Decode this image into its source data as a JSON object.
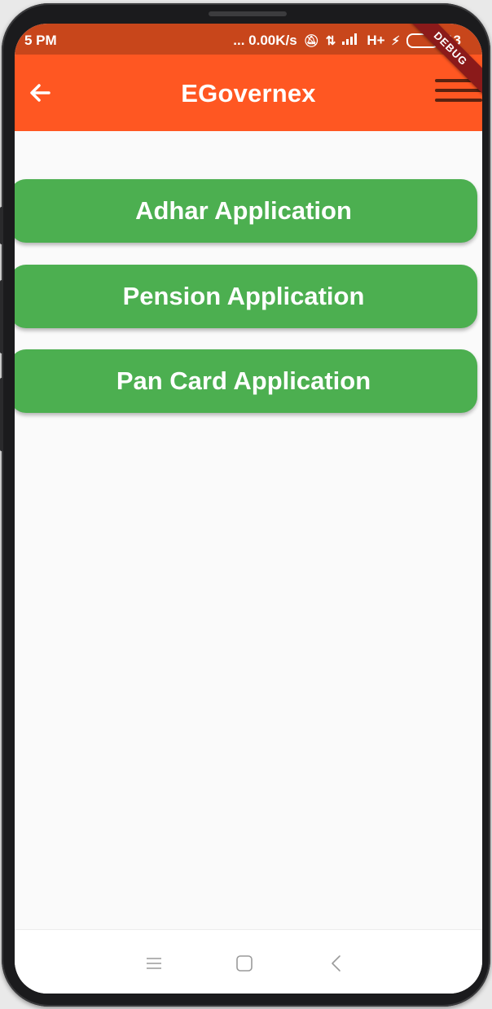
{
  "status_bar": {
    "time": "5 PM",
    "network_speed": "... 0.00K/s",
    "signal": "H+",
    "battery_level": "13"
  },
  "app_bar": {
    "title": "EGovernex",
    "debug_banner": "DEBUG",
    "back_icon": "arrow-left-icon",
    "menu_icon": "hamburger-menu-icon"
  },
  "buttons": [
    {
      "label": "Adhar Application"
    },
    {
      "label": "Pension Application"
    },
    {
      "label": "Pan Card Application"
    }
  ],
  "nav_bar": {
    "recents_icon": "recents-icon",
    "home_icon": "home-icon",
    "back_icon": "back-icon"
  },
  "colors": {
    "app_bar": "#ff5722",
    "status_bar": "#c8461b",
    "button": "#4caf50",
    "background": "#fafafa"
  }
}
